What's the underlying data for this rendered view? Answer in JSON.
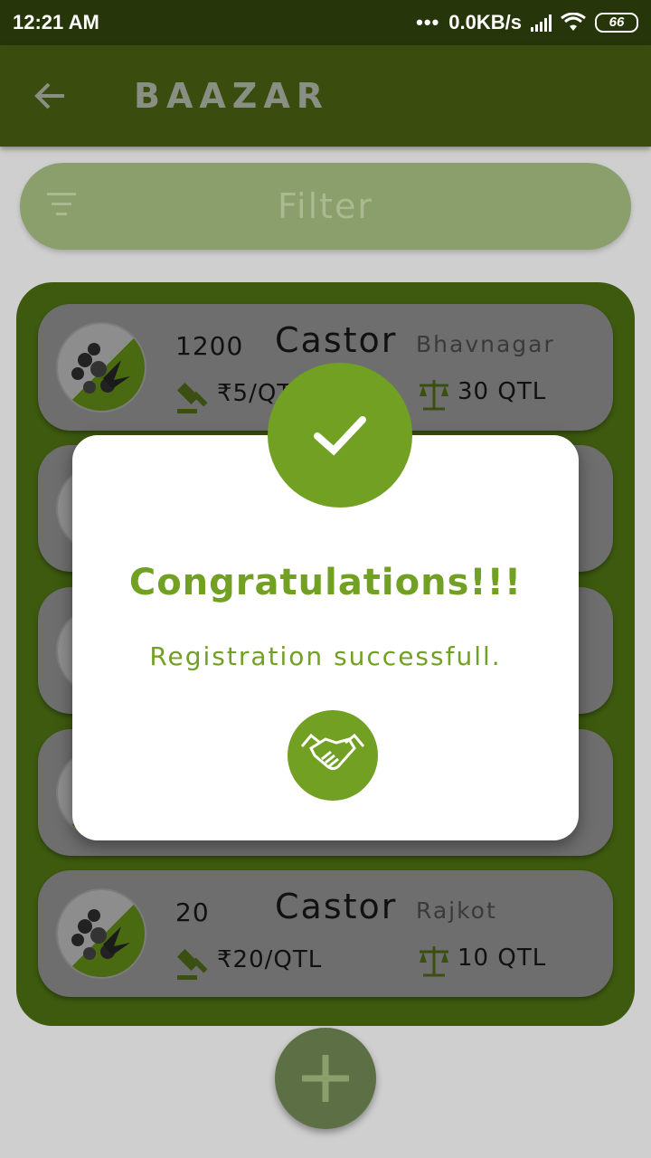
{
  "status_bar": {
    "time": "12:21 AM",
    "dots": "•••",
    "network_speed": "0.0KB/s",
    "battery": "66"
  },
  "app_bar": {
    "title": "BAAZAR",
    "back_icon": "arrow-left-icon"
  },
  "filter": {
    "label": "Filter",
    "icon": "filter-lines-icon"
  },
  "listings": [
    {
      "quantity": "1200",
      "crop": "Castor",
      "city": "Bhavnagar",
      "bid": "₹5/QTL",
      "weight": "30 QTL"
    },
    {
      "quantity": "",
      "crop": "",
      "city": "",
      "bid": "",
      "weight": ""
    },
    {
      "quantity": "",
      "crop": "",
      "city": "",
      "bid": "",
      "weight": ""
    },
    {
      "quantity": "",
      "crop": "",
      "city": "",
      "bid": "",
      "weight": ""
    },
    {
      "quantity": "20",
      "crop": "Castor",
      "city": "Rajkot",
      "bid": "₹20/QTL",
      "weight": "10 QTL"
    }
  ],
  "dialog": {
    "title": "Congratulations!!!",
    "message": "Registration successfull.",
    "top_icon": "check-icon",
    "bottom_icon": "handshake-icon"
  },
  "fab": {
    "icon": "plus-icon"
  },
  "colors": {
    "accent": "#72a023",
    "app_bar": "#3a4d0e",
    "status_bar": "#27360a",
    "panel": "#3d5a0f"
  }
}
